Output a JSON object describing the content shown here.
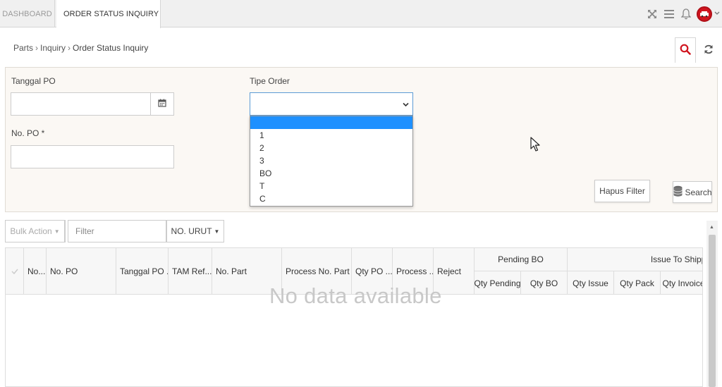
{
  "tabs": [
    {
      "label": "DASHBOARD"
    },
    {
      "label": "ORDER STATUS INQUIRY",
      "close": "×"
    }
  ],
  "breadcrumb": [
    "Parts",
    "Inquiry",
    "Order Status Inquiry"
  ],
  "filters": {
    "tanggal_po_label": "Tanggal PO",
    "tanggal_po_value": "",
    "no_po_label": "No. PO *",
    "no_po_value": "",
    "tipe_order_label": "Tipe Order",
    "tipe_order_value": "",
    "tipe_order_options": [
      "",
      "1",
      "2",
      "3",
      "BO",
      "T",
      "C"
    ],
    "hapus_filter": "Hapus Filter",
    "search": "Search"
  },
  "toolbar": {
    "bulk_action": "Bulk Action",
    "filter_placeholder": "Filter",
    "sort_label": "NO. URUT"
  },
  "table": {
    "columns": [
      "No....",
      "No. PO",
      "Tanggal PO ...",
      "TAM Ref...",
      "No. Part",
      "Process No. Part ...",
      "Qty PO ...",
      "Process ...",
      "Reject"
    ],
    "groups": [
      {
        "label": "Pending BO",
        "sub": [
          "Qty Pending",
          "Qty BO"
        ]
      },
      {
        "label": "Issue To Shippi",
        "sub": [
          "Qty Issue",
          "Qty Pack",
          "Qty Invoice"
        ]
      }
    ],
    "empty_text": "No data available"
  },
  "icons": [
    "expand-icon",
    "menu-icon",
    "bell-icon",
    "avatar",
    "search-icon",
    "refresh-icon",
    "calendar-icon",
    "database-icon"
  ],
  "colors": {
    "accent": "#d0141e",
    "selection": "#1e90ff",
    "select_border": "#5b9bd5"
  }
}
